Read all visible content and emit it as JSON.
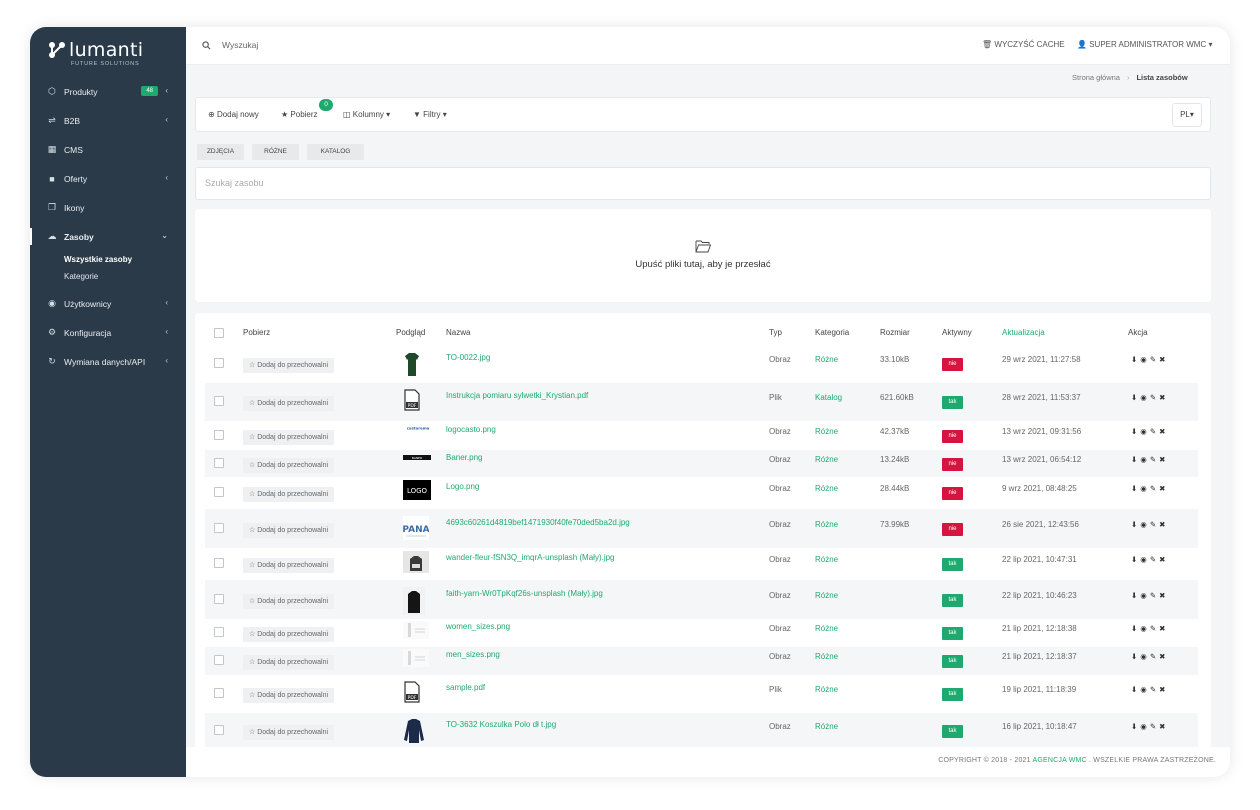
{
  "brand": {
    "name": "lumanti",
    "tagline": "FUTURE SOLUTIONS",
    "accent": "#1eaa6f",
    "sidebar_bg": "#2b3a48"
  },
  "sidebar": {
    "items": [
      {
        "label": "Produkty",
        "icon": "cube-icon",
        "badge": "48",
        "has_chevron": true
      },
      {
        "label": "B2B",
        "icon": "handshake-icon",
        "has_chevron": true
      },
      {
        "label": "CMS",
        "icon": "layout-icon",
        "has_chevron": false
      },
      {
        "label": "Oferty",
        "icon": "briefcase-icon",
        "has_chevron": true
      },
      {
        "label": "Ikony",
        "icon": "copy-icon",
        "has_chevron": false
      },
      {
        "label": "Zasoby",
        "icon": "cloud-icon",
        "has_chevron": true,
        "active": true
      },
      {
        "label": "Użytkownicy",
        "icon": "eye-icon",
        "has_chevron": true
      },
      {
        "label": "Konfiguracja",
        "icon": "gear-icon",
        "has_chevron": true
      },
      {
        "label": "Wymiana danych/API",
        "icon": "sync-icon",
        "has_chevron": true
      }
    ],
    "subitems": [
      "Wszystkie zasoby",
      "Kategorie"
    ]
  },
  "topbar": {
    "search_placeholder": "Wyszukaj",
    "clear_cache": "WYCZYŚĆ CACHE",
    "user": "SUPER ADMINISTRATOR WMC"
  },
  "breadcrumb": {
    "home": "Strona główna",
    "current": "Lista zasobów"
  },
  "toolbar": {
    "add_new": "Dodaj nowy",
    "download": "Pobierz",
    "download_count": "0",
    "columns": "Kolumny",
    "filters": "Filtry",
    "language": "PL"
  },
  "filter_tabs": [
    "ZDJĘCIA",
    "RÓŻNE",
    "KATALOG"
  ],
  "asset_search_placeholder": "Szukaj zasobu",
  "dropzone_text": "Upuść pliki tutaj, aby je przesłać",
  "table": {
    "headers": {
      "download": "Pobierz",
      "preview": "Podgląd",
      "name": "Nazwa",
      "type": "Typ",
      "category": "Kategoria",
      "size": "Rozmiar",
      "active": "Aktywny",
      "updated": "Aktualizacja",
      "action": "Akcja"
    },
    "store_label": "☆ Dodaj do przechowalni",
    "rows": [
      {
        "name": "TO-0022.jpg",
        "type": "Obraz",
        "category": "Różne",
        "size": "33.10kB",
        "active": "nie",
        "updated": "29 wrz 2021, 11:27:58",
        "thumb": "tshirt-green"
      },
      {
        "name": "Instrukcja pomiaru sylwetki_Krystian.pdf",
        "type": "Plik",
        "category": "Katalog",
        "size": "621.60kB",
        "active": "tak",
        "updated": "28 wrz 2021, 11:53:37",
        "thumb": "pdf"
      },
      {
        "name": "logocasto.png",
        "type": "Obraz",
        "category": "Różne",
        "size": "42.37kB",
        "active": "nie",
        "updated": "13 wrz 2021, 09:31:56",
        "thumb": "logo-casto"
      },
      {
        "name": "Baner.png",
        "type": "Obraz",
        "category": "Różne",
        "size": "13.24kB",
        "active": "nie",
        "updated": "13 wrz 2021, 06:54:12",
        "thumb": "baner"
      },
      {
        "name": "Logo.png",
        "type": "Obraz",
        "category": "Różne",
        "size": "28.44kB",
        "active": "nie",
        "updated": "9 wrz 2021, 08:48:25",
        "thumb": "logo-black",
        "thumb_text": "LOGO"
      },
      {
        "name": "4693c60261d4819bef1471930f40fe70ded5ba2d.jpg",
        "type": "Obraz",
        "category": "Różne",
        "size": "73.99kB",
        "active": "nie",
        "updated": "26 sie 2021, 12:43:56",
        "thumb": "pana",
        "thumb_text": "PANA"
      },
      {
        "name": "wander-fleur-fSN3Q_imqrA-unsplash (Mały).jpg",
        "type": "Obraz",
        "category": "Różne",
        "size": "",
        "active": "tak",
        "updated": "22 lip 2021, 10:47:31",
        "thumb": "photo-grey"
      },
      {
        "name": "faith-yarn-Wr0TpKqf26s-unsplash (Mały).jpg",
        "type": "Obraz",
        "category": "Różne",
        "size": "",
        "active": "tak",
        "updated": "22 lip 2021, 10:46:23",
        "thumb": "photo-dark"
      },
      {
        "name": "women_sizes.png",
        "type": "Obraz",
        "category": "Różne",
        "size": "",
        "active": "tak",
        "updated": "21 lip 2021, 12:18:38",
        "thumb": "sizes"
      },
      {
        "name": "men_sizes.png",
        "type": "Obraz",
        "category": "Różne",
        "size": "",
        "active": "tak",
        "updated": "21 lip 2021, 12:18:37",
        "thumb": "sizes"
      },
      {
        "name": "sample.pdf",
        "type": "Plik",
        "category": "Różne",
        "size": "",
        "active": "tak",
        "updated": "19 lip 2021, 11:18:39",
        "thumb": "pdf"
      },
      {
        "name": "TO-3632 Koszulka Polo dł t.jpg",
        "type": "Obraz",
        "category": "Różne",
        "size": "",
        "active": "tak",
        "updated": "16 lip 2021, 10:18:47",
        "thumb": "polo-navy"
      }
    ]
  },
  "footer": {
    "prefix": "COPYRIGHT © 2018 - 2021",
    "agency": "AGENCJA WMC",
    "suffix": ". WSZELKIE PRAWA ZASTRZEŻONE."
  }
}
